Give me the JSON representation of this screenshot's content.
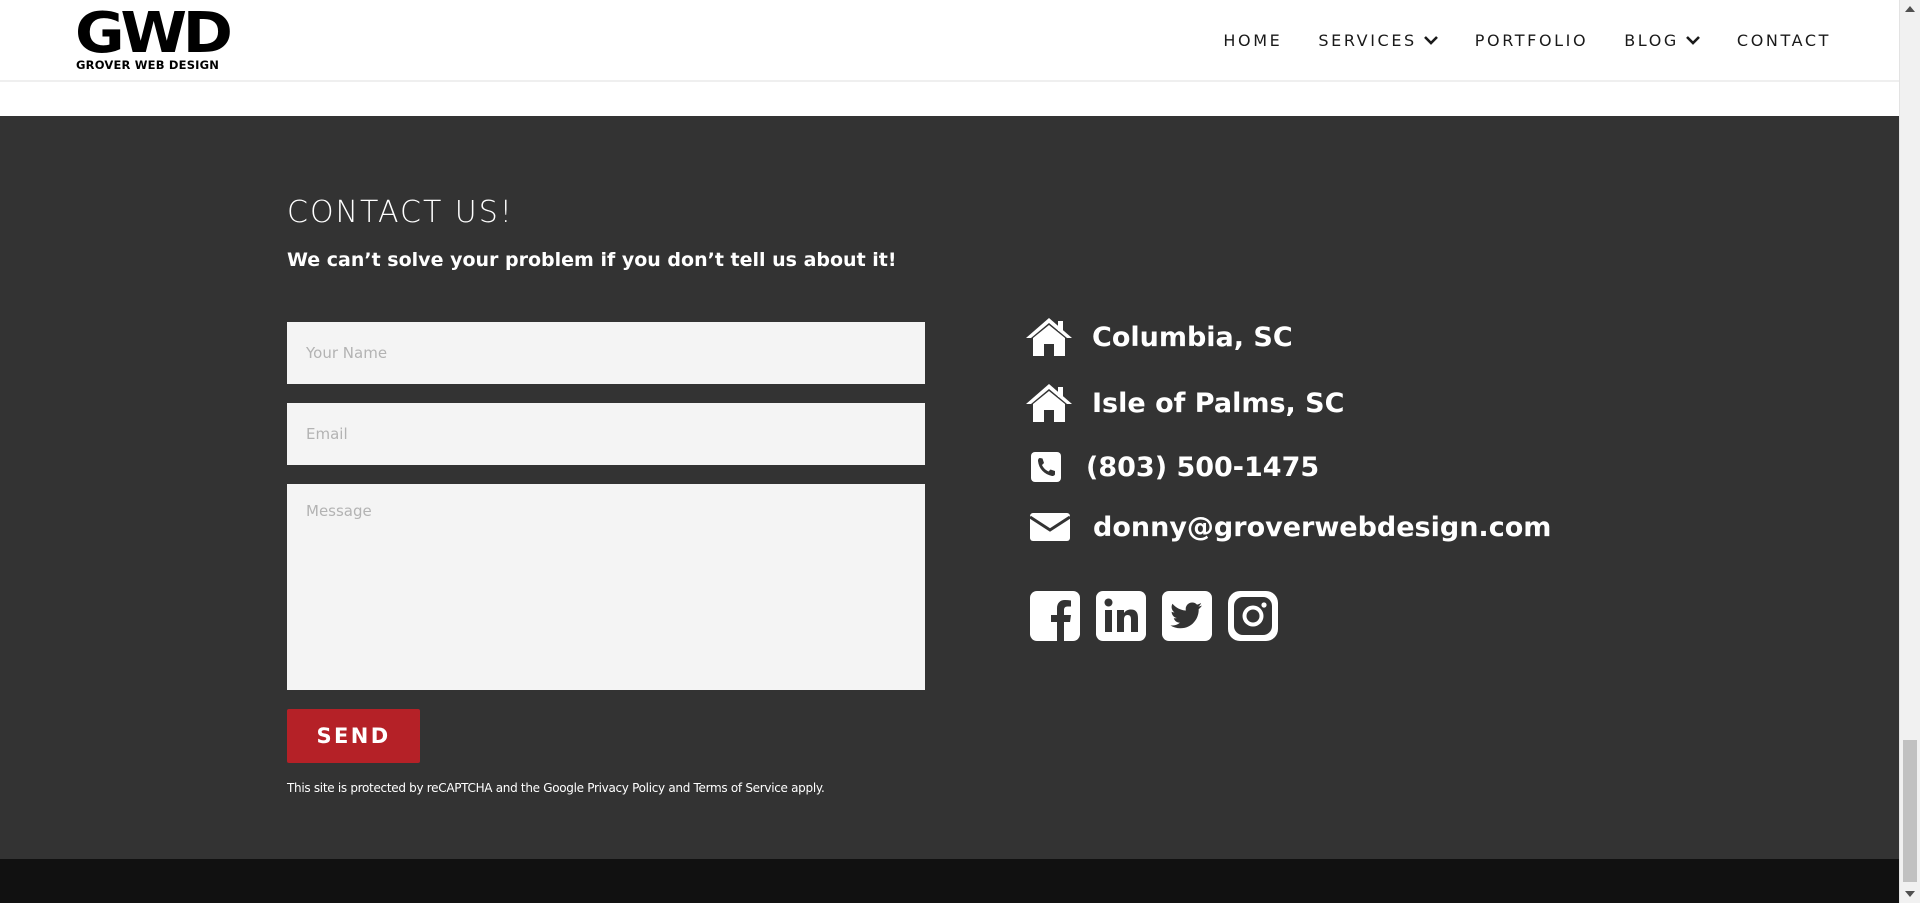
{
  "header": {
    "logo_mark": "GWD",
    "logo_text": "GROVER WEB DESIGN",
    "nav": [
      {
        "label": "HOME",
        "has_dropdown": false
      },
      {
        "label": "SERVICES",
        "has_dropdown": true
      },
      {
        "label": "PORTFOLIO",
        "has_dropdown": false
      },
      {
        "label": "BLOG",
        "has_dropdown": true
      },
      {
        "label": "CONTACT",
        "has_dropdown": false
      }
    ]
  },
  "contact": {
    "title": "CONTACT US!",
    "subtitle": "We can’t solve your problem if you don’t tell us about it!",
    "form": {
      "name_placeholder": "Your Name",
      "email_placeholder": "Email",
      "message_placeholder": "Message",
      "send_label": "SEND"
    },
    "recaptcha_text": "This site is protected by reCAPTCHA and the Google Privacy Policy and Terms of Service apply.",
    "info": {
      "location_1": "Columbia, SC",
      "location_2": "Isle of Palms, SC",
      "phone": "(803) 500-1475",
      "email": "donny@groverwebdesign.com"
    },
    "social_icons": [
      "facebook-icon",
      "linkedin-icon",
      "twitter-icon",
      "instagram-icon"
    ]
  },
  "colors": {
    "section_bg": "#333333",
    "footer_bg": "#111111",
    "send_button": "#b52127",
    "input_bg": "#f4f4f4"
  }
}
